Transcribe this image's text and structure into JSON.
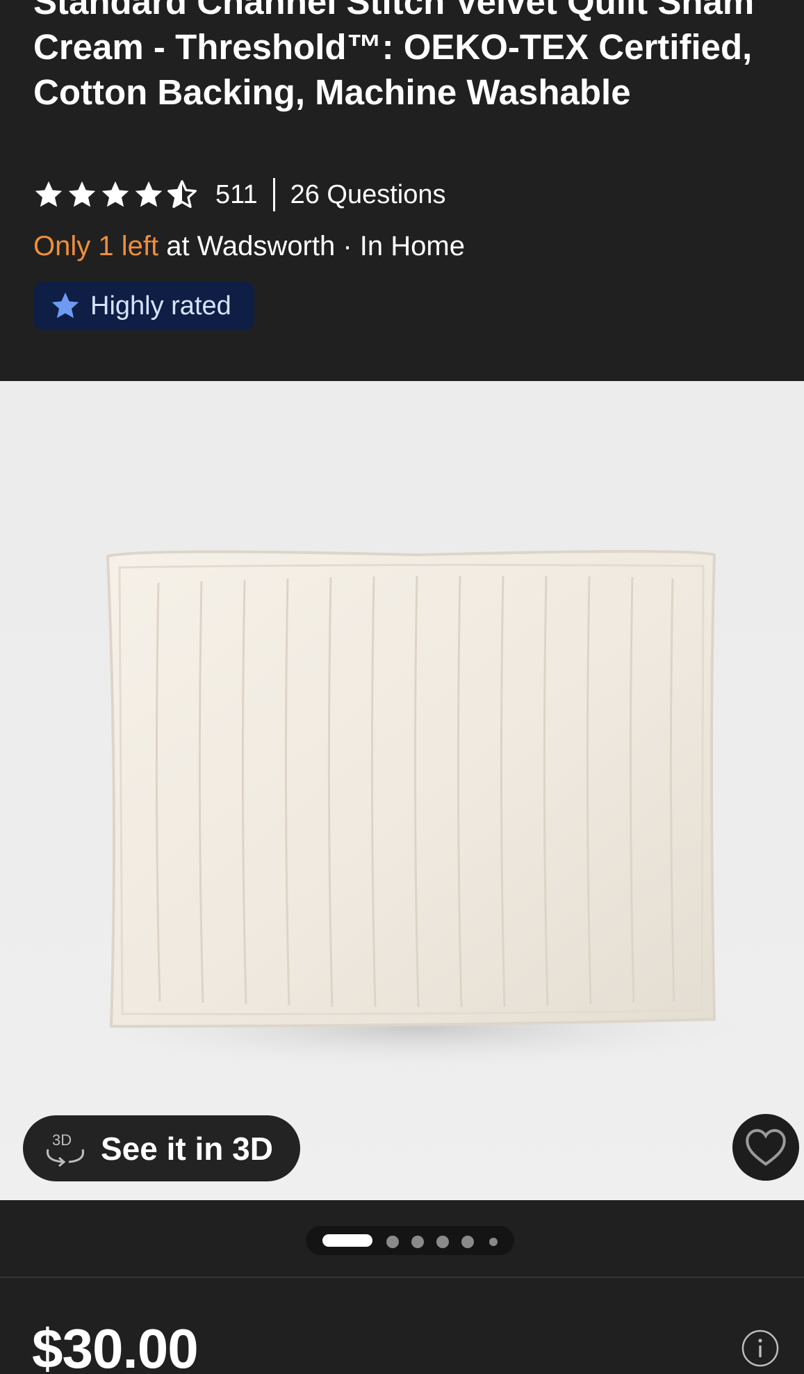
{
  "product": {
    "title": "Standard Channel Stitch Velvet Quilt Sham Cream - Threshold™: OEKO-TEX Certified, Cotton Backing, Machine Washable",
    "rating": 4.5,
    "review_count": "511",
    "questions": "26 Questions",
    "stock_highlight": "Only 1 left",
    "stock_rest": " at Wadsworth · In Home",
    "badge_label": "Highly rated",
    "see_3d_label": "See it in 3D",
    "price": "$30.00"
  },
  "gallery": {
    "total_images": 6,
    "active_index": 0
  },
  "colors": {
    "background": "#202020",
    "stock_accent": "#ef8f3b",
    "badge_bg": "#0f1e45",
    "badge_star": "#6e9bf2"
  },
  "icons": {
    "rating": "star-icon",
    "badge": "star-icon",
    "three_d": "3d-rotate-icon",
    "favorite": "heart-icon",
    "info": "info-icon"
  }
}
